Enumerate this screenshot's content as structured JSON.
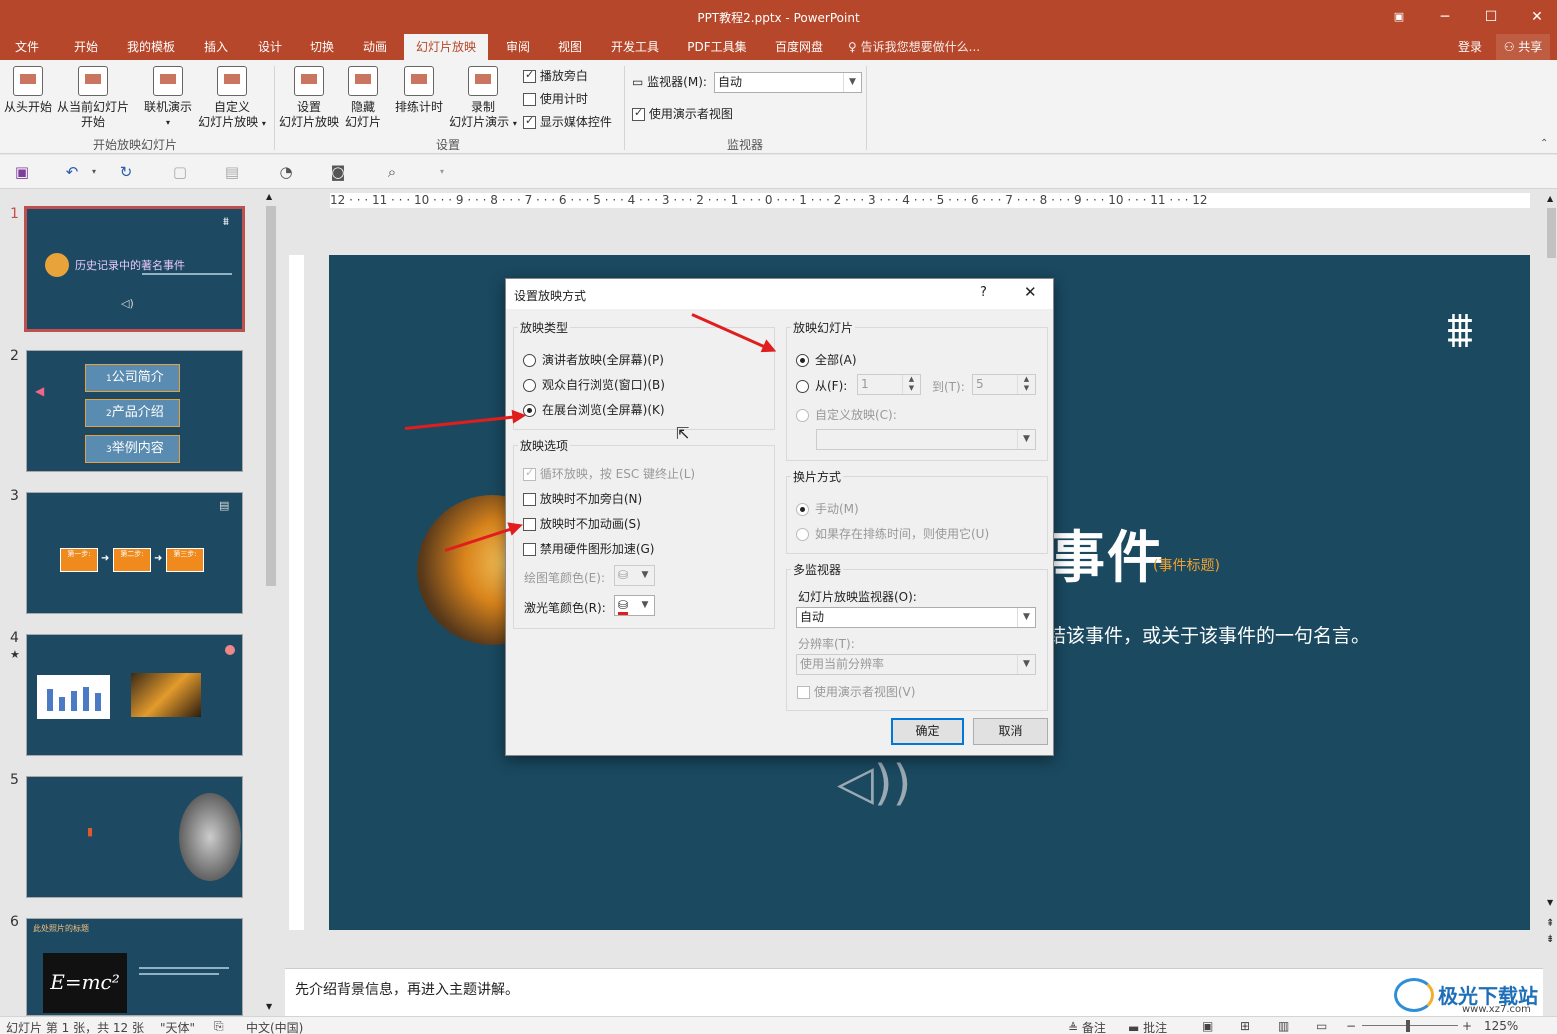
{
  "app": {
    "title": "PPT教程2.pptx - PowerPoint"
  },
  "tabs": [
    "文件",
    "开始",
    "我的模板",
    "插入",
    "设计",
    "切换",
    "动画",
    "幻灯片放映",
    "审阅",
    "视图",
    "开发工具",
    "PDF工具集",
    "百度网盘"
  ],
  "tell_me": "告诉我您想要做什么...",
  "account": {
    "login": "登录",
    "share": "共享"
  },
  "ribbon": {
    "start_group": {
      "label": "开始放映幻灯片",
      "from_start": "从头开始",
      "from_current_1": "从当前幻灯片",
      "from_current_2": "开始",
      "online_1": "联机演示",
      "custom_1": "自定义",
      "custom_2": "幻灯片放映"
    },
    "setup_group": {
      "label": "设置",
      "setup_1": "设置",
      "setup_2": "幻灯片放映",
      "hide_1": "隐藏",
      "hide_2": "幻灯片",
      "rehearse": "排练计时",
      "record_1": "录制",
      "record_2": "幻灯片演示",
      "play_narration": "播放旁白",
      "use_timings": "使用计时",
      "show_media": "显示媒体控件"
    },
    "monitor_group": {
      "label": "监视器",
      "monitor_label": "监视器(M):",
      "monitor_value": "自动",
      "presenter_view": "使用演示者视图"
    }
  },
  "thumbnails": {
    "s1_title": "历史记录中的著名事件",
    "s2_items": [
      "公司简介",
      "产品介绍",
      "举例内容"
    ],
    "s3_steps": [
      "第一步:",
      "第二步:",
      "第三步:"
    ],
    "s6_title": "此处照片的标题",
    "nums": [
      "1",
      "2",
      "3",
      "4",
      "5",
      "6"
    ]
  },
  "ruler": {
    "h": "12 · · · 11 · · · 10 · · · 9 · · · 8 · · · 7 · · · 6 · · · 5 · · · 4 · · · 3 · · · 2 · · · 1 · · · 0 · · · 1 · · · 2 · · · 3 · · · 4 · · · 5 · · · 6 · · · 7 · · · 8 · · · 9 · · · 10 · · · 11 · · · 12"
  },
  "slide": {
    "title_fragment": "事件",
    "title_hint": "(事件标题)",
    "subtitle_fragment": "结该事件，或关于该事件的一句名言。"
  },
  "notes": "先介绍背景信息，再进入主题讲解。",
  "dialog": {
    "title": "设置放映方式",
    "help": "?",
    "show_type": {
      "label": "放映类型",
      "options": [
        "演讲者放映(全屏幕)(P)",
        "观众自行浏览(窗口)(B)",
        "在展台浏览(全屏幕)(K)"
      ]
    },
    "show_options": {
      "label": "放映选项",
      "loop": "循环放映，按 ESC 键终止(L)",
      "no_narration": "放映时不加旁白(N)",
      "no_animation": "放映时不加动画(S)",
      "no_hw_accel": "禁用硬件图形加速(G)",
      "pen_color": "绘图笔颜色(E):",
      "laser_color": "激光笔颜色(R):"
    },
    "show_slides": {
      "label": "放映幻灯片",
      "all": "全部(A)",
      "from": "从(F):",
      "from_value": "1",
      "to": "到(T):",
      "to_value": "5",
      "custom": "自定义放映(C):"
    },
    "advance": {
      "label": "换片方式",
      "manual": "手动(M)",
      "timings": "如果存在排练时间，则使用它(U)"
    },
    "multi_monitor": {
      "label": "多监视器",
      "monitor_label": "幻灯片放映监视器(O):",
      "monitor_value": "自动",
      "resolution_label": "分辨率(T):",
      "resolution_value": "使用当前分辨率",
      "presenter_view": "使用演示者视图(V)"
    },
    "ok": "确定",
    "cancel": "取消"
  },
  "status": {
    "slide_info": "幻灯片 第 1 张，共 12 张",
    "theme": "\"天体\"",
    "language": "中文(中国)",
    "notes": "备注",
    "comments": "批注",
    "zoom": "125%"
  },
  "watermark": {
    "text": "极光下载站",
    "url": "www.xz7.com"
  },
  "colors": {
    "accent": "#b7472a",
    "slide_bg": "#1a4960",
    "arrow": "#e01e1e",
    "laser": "#e01e1e"
  }
}
